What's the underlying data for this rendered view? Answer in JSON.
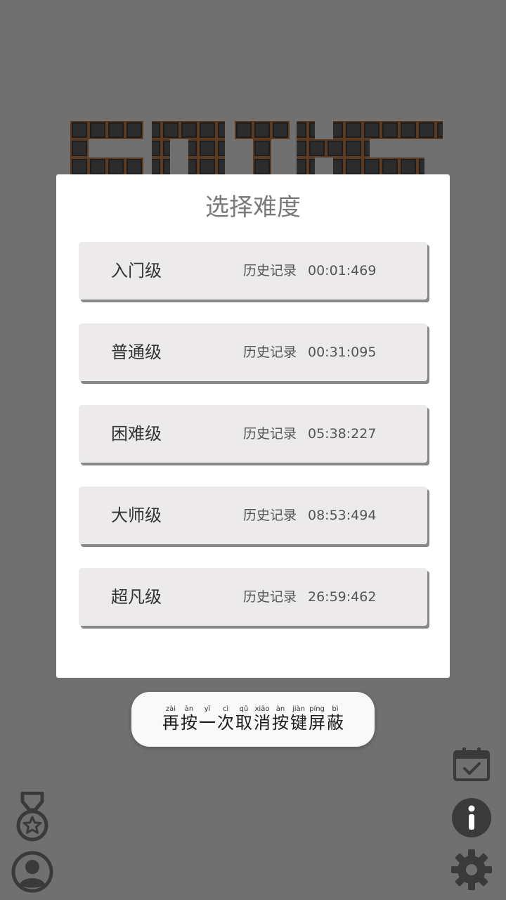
{
  "dialog": {
    "title": "选择难度",
    "levels": [
      {
        "name": "入门级",
        "record_label": "历史记录",
        "record_time": "00:01:469"
      },
      {
        "name": "普通级",
        "record_label": "历史记录",
        "record_time": "00:31:095"
      },
      {
        "name": "困难级",
        "record_label": "历史记录",
        "record_time": "05:38:227"
      },
      {
        "name": "大师级",
        "record_label": "历史记录",
        "record_time": "08:53:494"
      },
      {
        "name": "超凡级",
        "record_label": "历史记录",
        "record_time": "26:59:462"
      }
    ]
  },
  "toast": {
    "chars": [
      {
        "hanzi": "再",
        "pinyin": "zài"
      },
      {
        "hanzi": "按",
        "pinyin": "àn"
      },
      {
        "hanzi": "一",
        "pinyin": "yī"
      },
      {
        "hanzi": "次",
        "pinyin": "cì"
      },
      {
        "hanzi": "取",
        "pinyin": "qǔ"
      },
      {
        "hanzi": "消",
        "pinyin": "xiāo"
      },
      {
        "hanzi": "按",
        "pinyin": "àn"
      },
      {
        "hanzi": "键",
        "pinyin": "jiàn"
      },
      {
        "hanzi": "屏",
        "pinyin": "píng"
      },
      {
        "hanzi": "蔽",
        "pinyin": "bì"
      }
    ]
  },
  "icons": {
    "medal": "medal-star-icon",
    "profile": "user-profile-icon",
    "calendar": "calendar-check-icon",
    "info": "info-icon",
    "settings": "gear-icon"
  },
  "colors": {
    "background": "#707070",
    "dialog": "#ffffff",
    "row": "#eceaea",
    "icon": "#3a3a3a"
  }
}
